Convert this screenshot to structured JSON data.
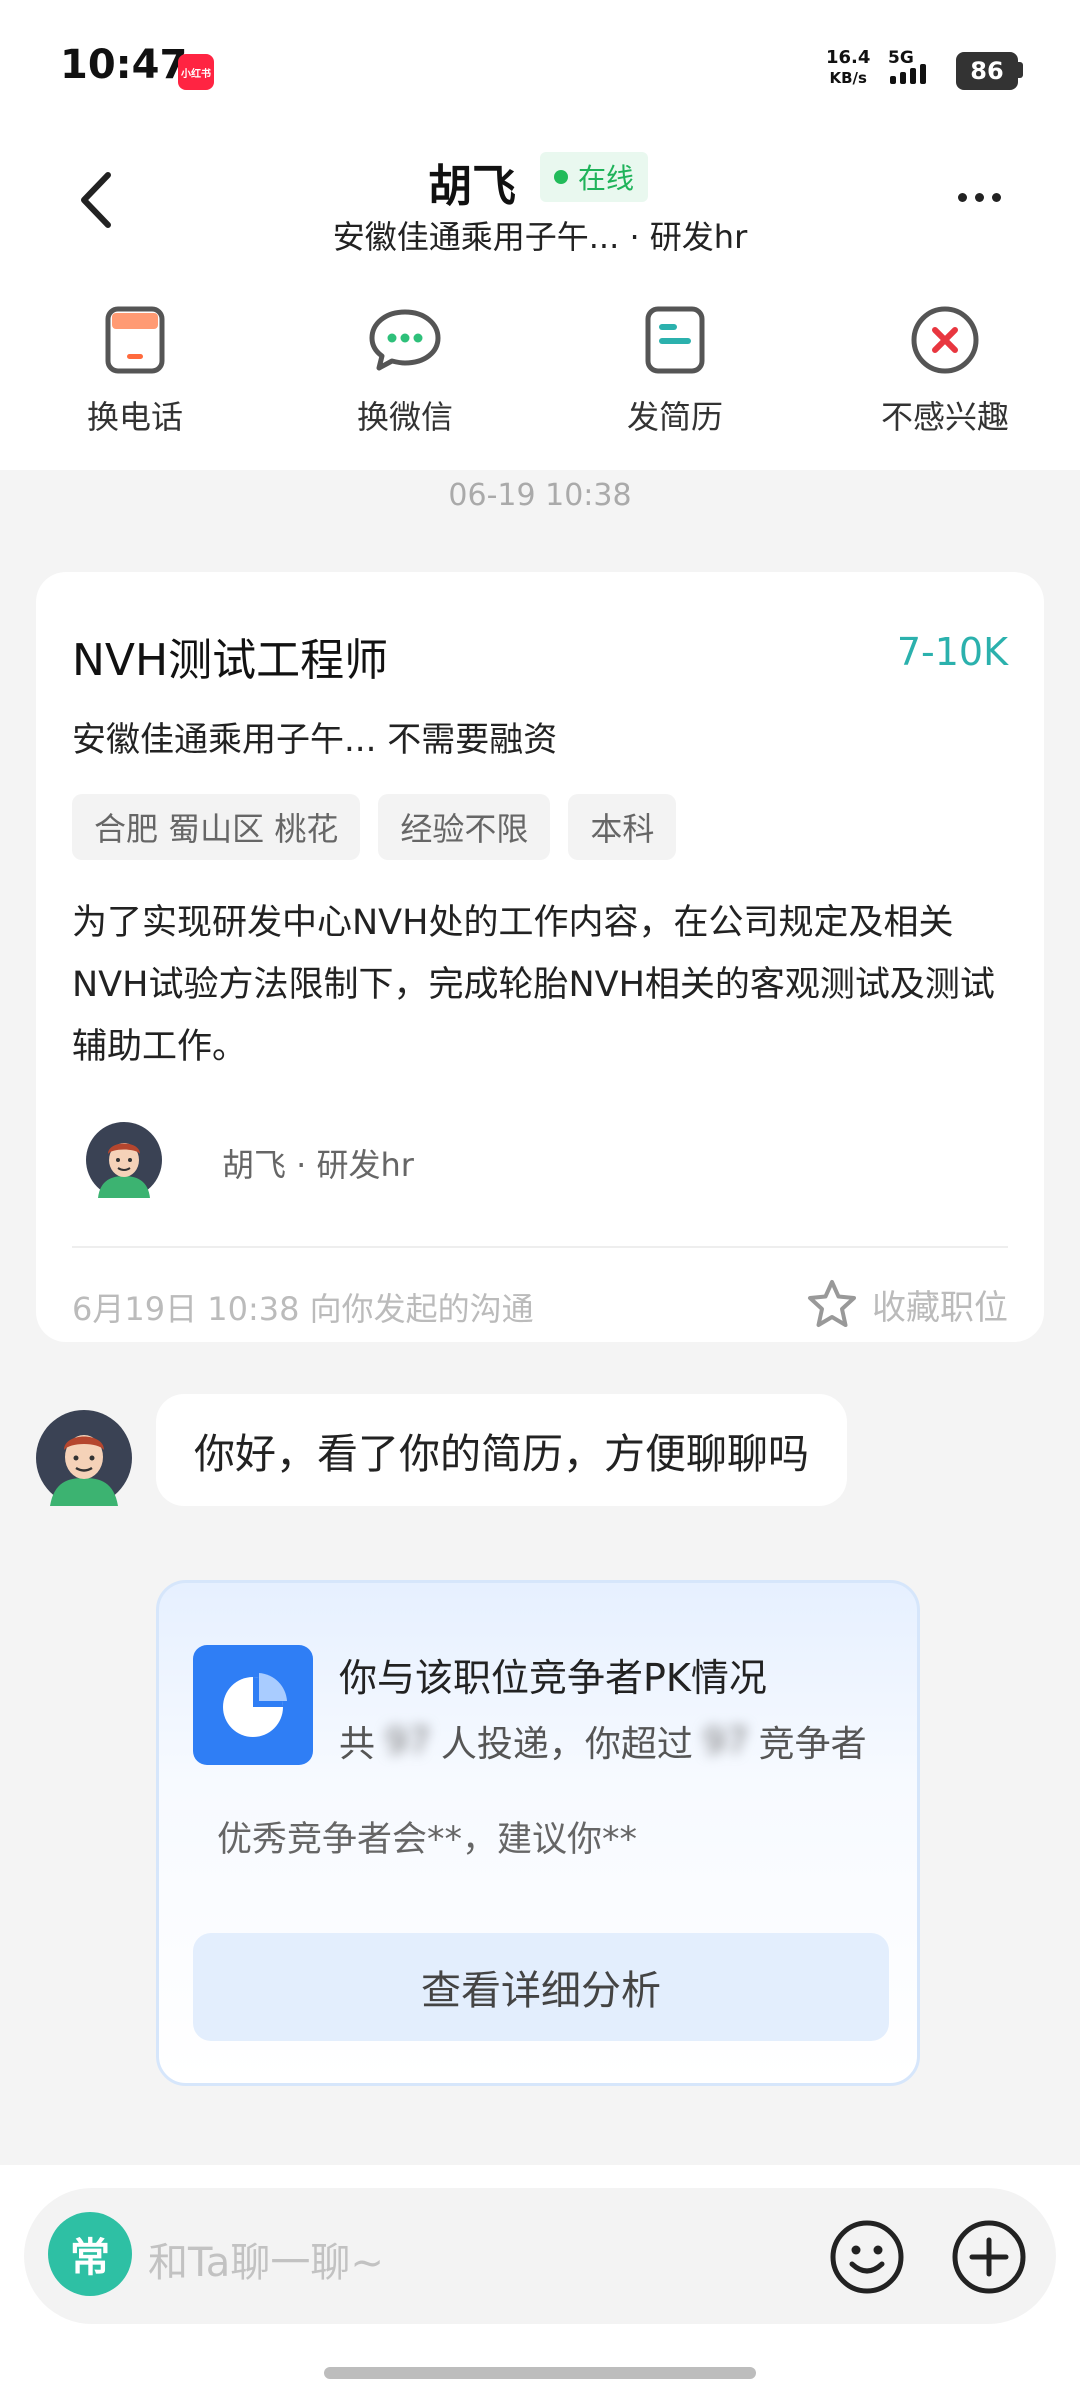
{
  "status_bar": {
    "time": "10:47",
    "app_badge": "小红书",
    "net_speed_value": "16.4",
    "net_speed_unit": "KB/s",
    "network": "5G",
    "battery": "86"
  },
  "header": {
    "name": "胡飞",
    "online_label": "在线",
    "subtitle": "安徽佳通乘用子午... · 研发hr",
    "actions": [
      {
        "label": "换电话",
        "icon": "phone-icon"
      },
      {
        "label": "换微信",
        "icon": "wechat-icon"
      },
      {
        "label": "发简历",
        "icon": "resume-icon"
      },
      {
        "label": "不感兴趣",
        "icon": "not-interested-icon"
      }
    ]
  },
  "chat": {
    "timestamp": "06-19 10:38",
    "job_card": {
      "title": "NVH测试工程师",
      "salary": "7-10K",
      "company": "安徽佳通乘用子午... 不需要融资",
      "tags": [
        "合肥 蜀山区 桃花",
        "经验不限",
        "本科"
      ],
      "description": "为了实现研发中心NVH处的工作内容，在公司规定及相关NVH试验方法限制下，完成轮胎NVH相关的客观测试及测试辅助工作。",
      "hr_info": "胡飞 · 研发hr",
      "footer_text": "6月19日 10:38 向你发起的沟通",
      "favorite_label": "收藏职位"
    },
    "message": "你好，看了你的简历，方便聊聊吗",
    "pk_card": {
      "title": "你与该职位竞争者PK情况",
      "sub_prefix": "共",
      "sub_count": "97",
      "sub_middle": "人投递，你超过",
      "sub_beaten": "97",
      "sub_suffix": "竞争者",
      "hint": "优秀竞争者会**，建议你**",
      "button": "查看详细分析"
    }
  },
  "input_bar": {
    "quick_label": "常",
    "placeholder": "和Ta聊一聊~"
  },
  "colors": {
    "accent_teal": "#2bb1ad",
    "online_green": "#1fb35a",
    "pk_blue": "#2f7ef5",
    "red": "#e8363f"
  }
}
